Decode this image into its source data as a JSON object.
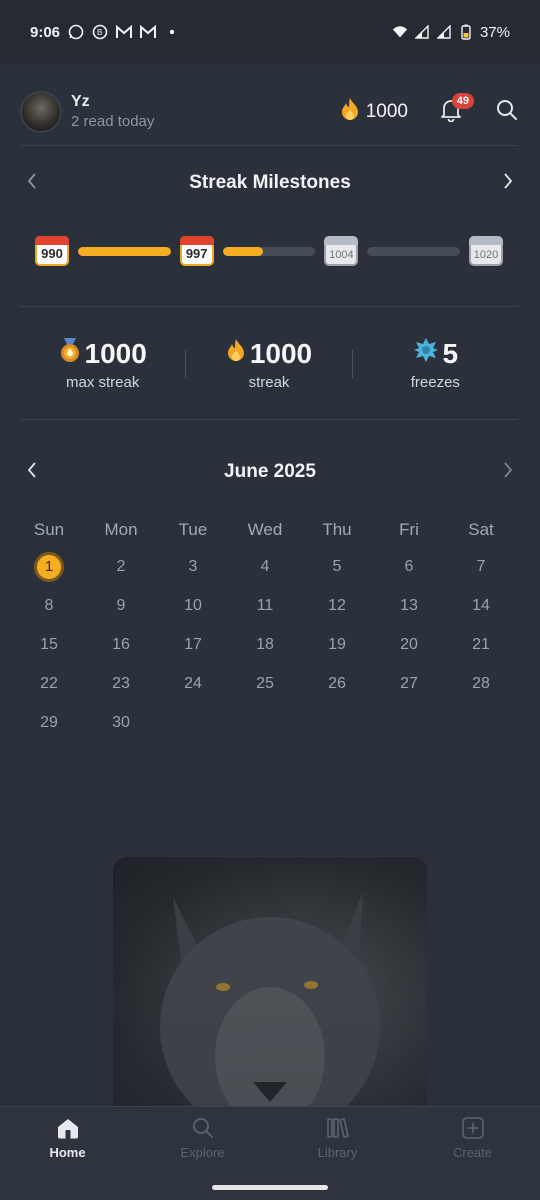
{
  "status_bar": {
    "time": "9:06",
    "battery": "37%",
    "left_icons": [
      "whatsapp-icon",
      "whatsapp-business-icon",
      "gmail-icon",
      "gmail-icon",
      "dot-icon"
    ],
    "right_icons": [
      "wifi-icon",
      "signal-icon",
      "signal-icon",
      "battery-icon"
    ]
  },
  "header": {
    "username": "Yz",
    "subtitle": "2 read today",
    "coins": "1000",
    "notification_count": "49"
  },
  "milestones": {
    "title": "Streak Milestones",
    "badges": [
      {
        "value": "990",
        "state": "achieved"
      },
      {
        "value": "997",
        "state": "achieved"
      },
      {
        "value": "1004",
        "state": "locked"
      },
      {
        "value": "1020",
        "state": "locked"
      }
    ],
    "progress": [
      1.0,
      0.43,
      0.0
    ]
  },
  "stats": {
    "max_streak_value": "1000",
    "max_streak_label": "max streak",
    "streak_value": "1000",
    "streak_label": "streak",
    "freezes_value": "5",
    "freezes_label": "freezes"
  },
  "calendar": {
    "title": "June 2025",
    "weekdays": [
      "Sun",
      "Mon",
      "Tue",
      "Wed",
      "Thu",
      "Fri",
      "Sat"
    ],
    "days": [
      "1",
      "2",
      "3",
      "4",
      "5",
      "6",
      "7",
      "8",
      "9",
      "10",
      "11",
      "12",
      "13",
      "14",
      "15",
      "16",
      "17",
      "18",
      "19",
      "20",
      "21",
      "22",
      "23",
      "24",
      "25",
      "26",
      "27",
      "28",
      "29",
      "30"
    ],
    "today": "1"
  },
  "nav": {
    "home": "Home",
    "explore": "Explore",
    "library": "Library",
    "create": "Create"
  },
  "colors": {
    "accent": "#f5ad22",
    "background": "#2b313a",
    "badge_red": "#d9433b"
  }
}
